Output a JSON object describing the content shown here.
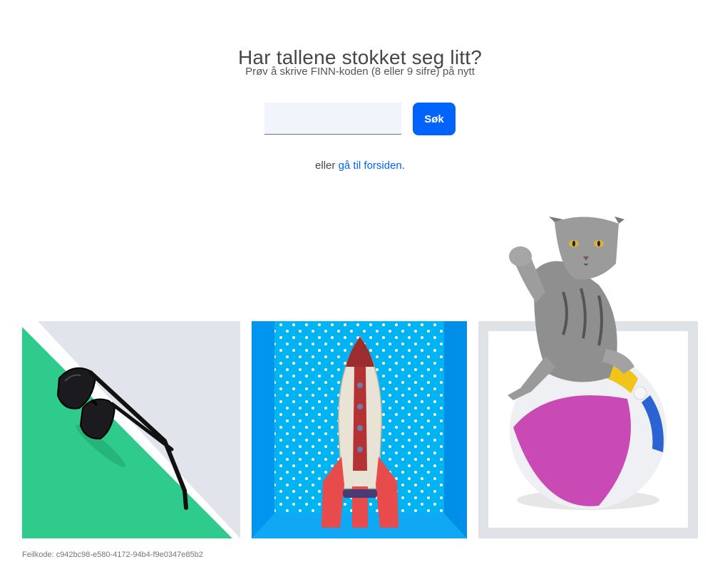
{
  "page": {
    "heading": "Har tallene stokket seg litt?",
    "subheading": "Prøv å skrive FINN-koden (8 eller 9 sifre) på nytt"
  },
  "search": {
    "value": "",
    "placeholder": "",
    "button_label": "Søk"
  },
  "alternative": {
    "prefix": "eller ",
    "link_label": "gå til forsiden",
    "suffix": "."
  },
  "illustrations": [
    {
      "name": "sunglasses-illustration",
      "background_colors": [
        "#2ecb8c",
        "#e1e4ea"
      ]
    },
    {
      "name": "rocket-illustration",
      "background_colors": [
        "#00b4f3",
        "#0095ee"
      ]
    },
    {
      "name": "cat-ball-illustration",
      "background_colors": [
        "#dfe3e8",
        "#ffffff"
      ]
    }
  ],
  "footer": {
    "error_code": "Feilkode: c942bc98-e580-4172-94b4-f9e0347e85b2"
  },
  "colors": {
    "accent": "#0063fb",
    "text": "#464646",
    "input_bg": "#f1f4fb"
  }
}
